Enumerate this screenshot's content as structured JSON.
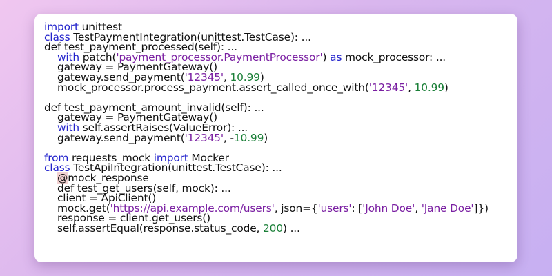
{
  "colors": {
    "keyword": "#2222cc",
    "string": "#7a1fa2",
    "number": "#1a7f37",
    "text": "#111111",
    "background_gradient": [
      "#f0c7f0",
      "#c7b0f2"
    ],
    "card": "#ffffff"
  },
  "code_lines": [
    {
      "indent": "",
      "tokens": [
        {
          "t": "import",
          "c": "kw"
        },
        {
          "t": " unittest",
          "c": "plain"
        }
      ]
    },
    {
      "indent": "",
      "tokens": [
        {
          "t": "class",
          "c": "kw"
        },
        {
          "t": " TestPaymentIntegration(unittest.TestCase): ...",
          "c": "plain"
        }
      ]
    },
    {
      "indent": "",
      "tokens": [
        {
          "t": "def test_payment_processed(self): ...",
          "c": "plain"
        }
      ]
    },
    {
      "indent": "    ",
      "tokens": [
        {
          "t": "with",
          "c": "kw"
        },
        {
          "t": " patch(",
          "c": "plain"
        },
        {
          "t": "'payment_processor.PaymentProcessor'",
          "c": "str"
        },
        {
          "t": ") ",
          "c": "plain"
        },
        {
          "t": "as",
          "c": "kw"
        },
        {
          "t": " mock_processor: ...",
          "c": "plain"
        }
      ]
    },
    {
      "indent": "    ",
      "tokens": [
        {
          "t": "gateway = PaymentGateway()",
          "c": "plain"
        }
      ]
    },
    {
      "indent": "    ",
      "tokens": [
        {
          "t": "gateway.send_payment(",
          "c": "plain"
        },
        {
          "t": "'12345'",
          "c": "str"
        },
        {
          "t": ", ",
          "c": "plain"
        },
        {
          "t": "10.99",
          "c": "num"
        },
        {
          "t": ")",
          "c": "plain"
        }
      ]
    },
    {
      "indent": "    ",
      "tokens": [
        {
          "t": "mock_processor.process_payment.assert_called_once_with(",
          "c": "plain"
        },
        {
          "t": "'12345'",
          "c": "str"
        },
        {
          "t": ", ",
          "c": "plain"
        },
        {
          "t": "10.99",
          "c": "num"
        },
        {
          "t": ")",
          "c": "plain"
        }
      ]
    },
    {
      "indent": "",
      "tokens": []
    },
    {
      "indent": "",
      "tokens": [
        {
          "t": "def test_payment_amount_invalid(self): ...",
          "c": "plain"
        }
      ]
    },
    {
      "indent": "    ",
      "tokens": [
        {
          "t": "gateway = PaymentGateway()",
          "c": "plain"
        }
      ]
    },
    {
      "indent": "    ",
      "tokens": [
        {
          "t": "with",
          "c": "kw"
        },
        {
          "t": " self.assertRaises(ValueError): ...",
          "c": "plain"
        }
      ]
    },
    {
      "indent": "    ",
      "tokens": [
        {
          "t": "gateway.send_payment(",
          "c": "plain"
        },
        {
          "t": "'12345'",
          "c": "str"
        },
        {
          "t": ", -",
          "c": "plain"
        },
        {
          "t": "10.99",
          "c": "num"
        },
        {
          "t": ")",
          "c": "plain"
        }
      ]
    },
    {
      "indent": "",
      "tokens": []
    },
    {
      "indent": "",
      "tokens": [
        {
          "t": "from",
          "c": "kw"
        },
        {
          "t": " requests_mock ",
          "c": "plain"
        },
        {
          "t": "import",
          "c": "kw"
        },
        {
          "t": " Mocker",
          "c": "plain"
        }
      ]
    },
    {
      "indent": "",
      "tokens": [
        {
          "t": "class",
          "c": "kw"
        },
        {
          "t": " TestApiIntegration(unittest.TestCase): ...",
          "c": "plain"
        }
      ]
    },
    {
      "indent": "    ",
      "tokens": [
        {
          "t": "@",
          "c": "decat"
        },
        {
          "t": "mock_response",
          "c": "plain"
        }
      ]
    },
    {
      "indent": "    ",
      "tokens": [
        {
          "t": "def test_get_users(self, mock): ...",
          "c": "plain"
        }
      ]
    },
    {
      "indent": "    ",
      "tokens": [
        {
          "t": "client = ApiClient()",
          "c": "plain"
        }
      ]
    },
    {
      "indent": "    ",
      "tokens": [
        {
          "t": "mock.get(",
          "c": "plain"
        },
        {
          "t": "'https://api.example.com/users'",
          "c": "str"
        },
        {
          "t": ", json={",
          "c": "plain"
        },
        {
          "t": "'users'",
          "c": "str"
        },
        {
          "t": ": [",
          "c": "plain"
        },
        {
          "t": "'John Doe'",
          "c": "str"
        },
        {
          "t": ", ",
          "c": "plain"
        },
        {
          "t": "'Jane Doe'",
          "c": "str"
        },
        {
          "t": "]})",
          "c": "plain"
        }
      ]
    },
    {
      "indent": "    ",
      "tokens": [
        {
          "t": "response = client.get_users()",
          "c": "plain"
        }
      ]
    },
    {
      "indent": "    ",
      "tokens": [
        {
          "t": "self.assertEqual(response.status_code, ",
          "c": "plain"
        },
        {
          "t": "200",
          "c": "num"
        },
        {
          "t": ") ...",
          "c": "plain"
        }
      ]
    }
  ]
}
